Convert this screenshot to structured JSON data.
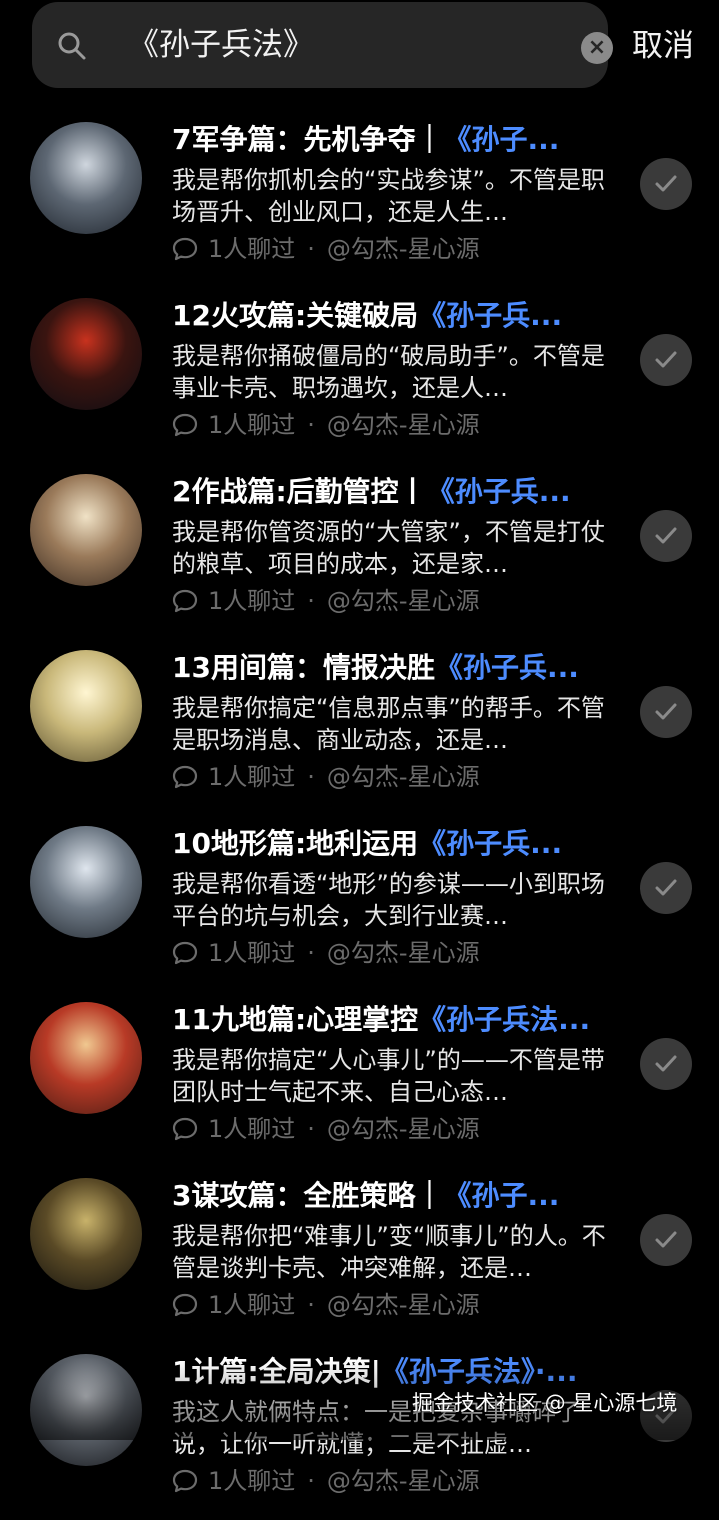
{
  "search": {
    "query": "《孙子兵法》",
    "cancel_label": "取消"
  },
  "results": [
    {
      "title_main": "7军争篇：先机争夺｜",
      "title_hl": "《孙子...",
      "desc": "我是帮你抓机会的“实战参谋”。不管是职场晋升、创业风口，还是人生…",
      "chats": "1人聊过",
      "author": "@勾杰-星心源",
      "avatar_colors": [
        "#cfd6de",
        "#5d6773",
        "#1e242c"
      ]
    },
    {
      "title_main": "12火攻篇:关键破局",
      "title_hl": "《孙子兵...",
      "desc": "我是帮你捅破僵局的“破局助手”。不管是事业卡壳、职场遇坎，还是人…",
      "chats": "1人聊过",
      "author": "@勾杰-星心源",
      "avatar_colors": [
        "#c8321e",
        "#3a1410",
        "#0d0d12"
      ]
    },
    {
      "title_main": "2作战篇:后勤管控丨",
      "title_hl": "《孙子兵...",
      "desc": "我是帮你管资源的“大管家”，不管是打仗的粮草、项目的成本，还是家…",
      "chats": "1人聊过",
      "author": "@勾杰-星心源",
      "avatar_colors": [
        "#f0e2c6",
        "#9a7a5a",
        "#3a2c22"
      ]
    },
    {
      "title_main": "13用间篇：情报决胜",
      "title_hl": "《孙子兵...",
      "desc": "我是帮你搞定“信息那点事”的帮手。不管是职场消息、商业动态，还是…",
      "chats": "1人聊过",
      "author": "@勾杰-星心源",
      "avatar_colors": [
        "#fff6d2",
        "#c9b87a",
        "#5a5030"
      ]
    },
    {
      "title_main": "10地形篇:地利运用",
      "title_hl": "《孙子兵...",
      "desc": "我是帮你看透“地形”的参谋——小到职场平台的坑与机会，大到行业赛…",
      "chats": "1人聊过",
      "author": "@勾杰-星心源",
      "avatar_colors": [
        "#dfe6ee",
        "#6f7a86",
        "#22282f"
      ]
    },
    {
      "title_main": "11九地篇:心理掌控",
      "title_hl": "《孙子兵法...",
      "desc": "我是帮你搞定“人心事儿”的——不管是带团队时士气起不来、自己心态…",
      "chats": "1人聊过",
      "author": "@勾杰-星心源",
      "avatar_colors": [
        "#f0c890",
        "#b83a26",
        "#4a1c14"
      ]
    },
    {
      "title_main": "3谋攻篇：全胜策略｜",
      "title_hl": "《孙子...",
      "desc": "我是帮你把“难事儿”变“顺事儿”的人。不管是谈判卡壳、冲突难解，还是…",
      "chats": "1人聊过",
      "author": "@勾杰-星心源",
      "avatar_colors": [
        "#c8b26a",
        "#5a4a26",
        "#16140e"
      ]
    },
    {
      "title_main": "1计篇:全局决策|",
      "title_hl": "《孙子兵法》·...",
      "desc": "我这人就俩特点：一是把复杂事嚼碎了说，让你一听就懂；二是不扯虚…",
      "chats": "1人聊过",
      "author": "@勾杰-星心源",
      "avatar_colors": [
        "#c8ccd2",
        "#5a6068",
        "#16181c"
      ]
    }
  ],
  "watermark": "掘金技术社区 @ 星心源七境"
}
